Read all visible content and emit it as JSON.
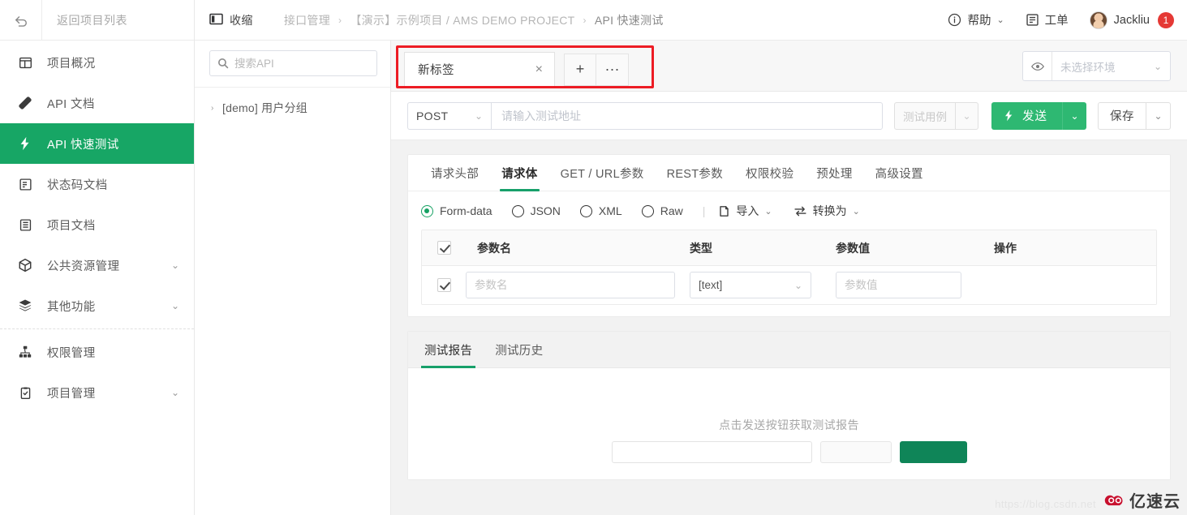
{
  "sidebar": {
    "back_label": "返回项目列表",
    "back_icon": "undo-arrow-icon",
    "items": [
      {
        "label": "项目概况",
        "icon": "dashboard-icon",
        "caret": "",
        "active": false
      },
      {
        "label": "API 文档",
        "icon": "tag-icon",
        "caret": "",
        "active": false
      },
      {
        "label": "API 快速测试",
        "icon": "lightning-icon",
        "caret": "",
        "active": true
      },
      {
        "label": "状态码文档",
        "icon": "file-code-icon",
        "caret": "",
        "active": false
      },
      {
        "label": "项目文档",
        "icon": "document-icon",
        "caret": "",
        "active": false
      },
      {
        "label": "公共资源管理",
        "icon": "box-icon",
        "caret": "⌄",
        "active": false
      },
      {
        "label": "其他功能",
        "icon": "layers-icon",
        "caret": "⌄",
        "active": false
      },
      {
        "label": "权限管理",
        "icon": "sitemap-icon",
        "caret": "",
        "active": false
      },
      {
        "label": "项目管理",
        "icon": "clipboard-icon",
        "caret": "⌄",
        "active": false
      }
    ]
  },
  "topbar": {
    "collapse_label": "收缩",
    "collapse_icon": "panel-collapse-icon",
    "breadcrumb": [
      "接口管理",
      "【演示】示例项目 / AMS DEMO PROJECT",
      "API 快速测试"
    ],
    "breadcrumb_sep": "›",
    "help_label": "帮助",
    "help_icon": "info-circle-icon",
    "help_caret": "⌄",
    "ticket_label": "工单",
    "ticket_icon": "ticket-icon",
    "user_name": "Jackliu",
    "user_avatar_icon": "avatar",
    "notification_count": "1"
  },
  "api_tree": {
    "search_placeholder": "搜索API",
    "search_value": "",
    "search_icon": "search-icon",
    "nodes": [
      {
        "label": "[demo] 用户分组",
        "expander": "›"
      }
    ]
  },
  "tabs_bar": {
    "tab_name": "新标签",
    "close_icon": "×",
    "add_label": "+",
    "more_label": "···",
    "highlight_color": "#ed1c24",
    "env": {
      "eye_icon": "eye-icon",
      "placeholder": "未选择环境",
      "caret": "⌄"
    }
  },
  "url_bar": {
    "method": "POST",
    "method_caret": "⌄",
    "url_placeholder": "请输入测试地址",
    "url_value": "",
    "testcase_label": "测试用例",
    "testcase_caret": "⌄",
    "send_label": "发送",
    "send_icon": "lightning-icon",
    "send_caret": "⌄",
    "send_color": "#2eb872",
    "save_label": "保存",
    "save_caret": "⌄"
  },
  "request": {
    "tabs": [
      {
        "label": "请求头部",
        "active": false
      },
      {
        "label": "请求体",
        "active": true
      },
      {
        "label": "GET / URL参数",
        "active": false
      },
      {
        "label": "REST参数",
        "active": false
      },
      {
        "label": "权限校验",
        "active": false
      },
      {
        "label": "预处理",
        "active": false
      },
      {
        "label": "高级设置",
        "active": false
      }
    ],
    "body_types": [
      {
        "label": "Form-data",
        "selected": true
      },
      {
        "label": "JSON",
        "selected": false
      },
      {
        "label": "XML",
        "selected": false
      },
      {
        "label": "Raw",
        "selected": false
      }
    ],
    "divider": "|",
    "import_label": "导入",
    "import_icon": "import-icon",
    "import_caret": "⌄",
    "convert_label": "转换为",
    "convert_icon": "swap-icon",
    "convert_caret": "⌄",
    "table": {
      "headers": [
        "参数名",
        "类型",
        "参数值",
        "操作"
      ],
      "rows": [
        {
          "checked": true,
          "name_placeholder": "参数名",
          "name_value": "",
          "type_value": "[text]",
          "type_caret": "⌄",
          "value_placeholder": "参数值",
          "value_value": "",
          "action": ""
        }
      ],
      "header_checked": true
    }
  },
  "report": {
    "tabs": [
      {
        "label": "测试报告",
        "active": true
      },
      {
        "label": "测试历史",
        "active": false
      }
    ],
    "empty_text": "点击发送按钮获取测试报告"
  },
  "watermark": {
    "url": "https://blog.csdn.net",
    "brand": "亿速云",
    "brand_icon": "cloud-swirl-logo",
    "brand_color": "#c8102e"
  }
}
